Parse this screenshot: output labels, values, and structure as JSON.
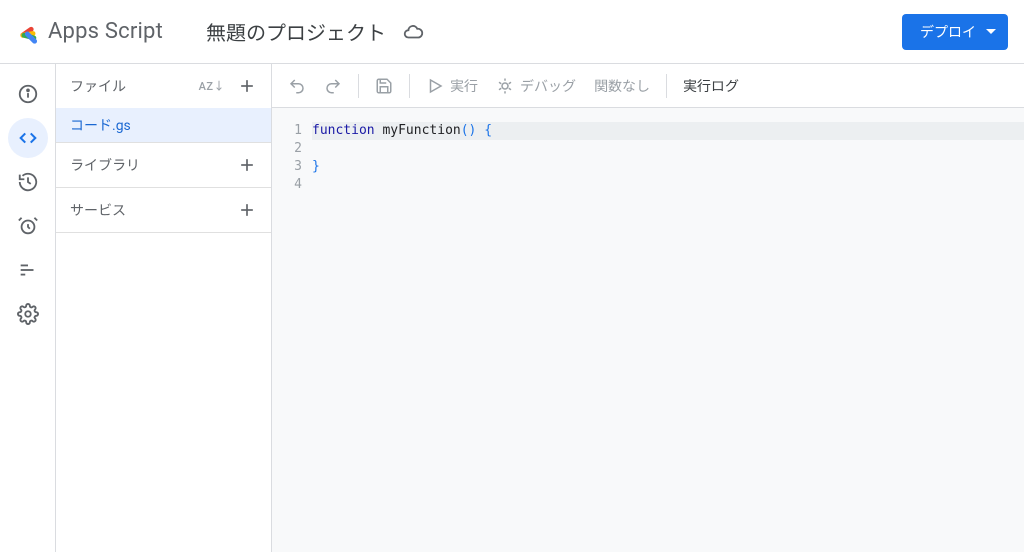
{
  "brand": {
    "name": "Apps Script"
  },
  "project": {
    "title": "無題のプロジェクト"
  },
  "deploy": {
    "label": "デプロイ"
  },
  "rail": {
    "info": {
      "name": "info-icon"
    },
    "editor": {
      "name": "editor-icon"
    },
    "history": {
      "name": "history-icon"
    },
    "triggers": {
      "name": "triggers-icon"
    },
    "executions": {
      "name": "executions-icon"
    },
    "settings": {
      "name": "settings-icon"
    }
  },
  "files": {
    "sections": [
      {
        "title": "ファイル",
        "sort_label": "AZ↓",
        "items": [
          {
            "name": "コード.gs",
            "selected": true
          }
        ]
      },
      {
        "title": "ライブラリ",
        "items": []
      },
      {
        "title": "サービス",
        "items": []
      }
    ]
  },
  "toolbar": {
    "undo": "undo",
    "redo": "redo",
    "save": "save",
    "run": "実行",
    "debug": "デバッグ",
    "func_select": "関数なし",
    "exec_log": "実行ログ"
  },
  "code": {
    "lines": [
      {
        "n": 1,
        "tokens": [
          {
            "t": "function",
            "c": "kw"
          },
          {
            "t": " ",
            "c": ""
          },
          {
            "t": "myFunction",
            "c": "fn"
          },
          {
            "t": "()",
            "c": "pn"
          },
          {
            "t": " {",
            "c": "pn"
          }
        ]
      },
      {
        "n": 2,
        "tokens": [
          {
            "t": "  ",
            "c": ""
          }
        ]
      },
      {
        "n": 3,
        "tokens": [
          {
            "t": "}",
            "c": "pn"
          }
        ]
      },
      {
        "n": 4,
        "tokens": []
      }
    ],
    "active_line": 1
  }
}
